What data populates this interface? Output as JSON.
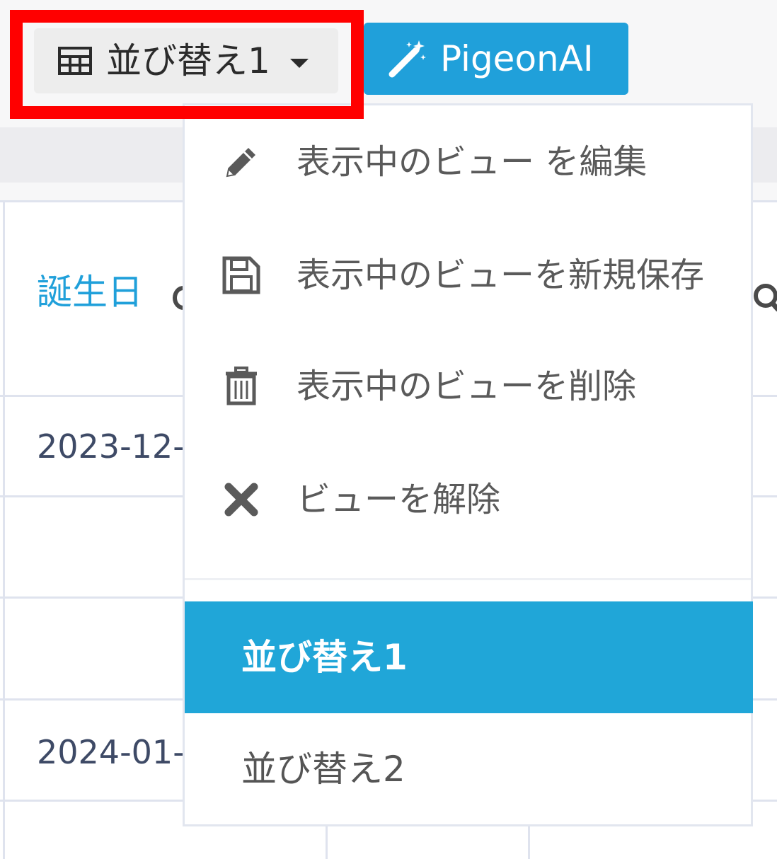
{
  "toolbar": {
    "view_button_label": "並び替え1",
    "ai_button_label": "PigeonAI"
  },
  "table": {
    "column_header": "誕生日",
    "cells": [
      "2023-12-",
      "2024-01-"
    ]
  },
  "dropdown": {
    "actions": [
      {
        "label": "表示中のビュー を編集",
        "icon": "pencil-icon"
      },
      {
        "label": "表示中のビューを新規保存",
        "icon": "save-icon"
      },
      {
        "label": "表示中のビューを削除",
        "icon": "trash-icon"
      },
      {
        "label": "ビューを解除",
        "icon": "close-icon"
      }
    ],
    "views": [
      {
        "label": "並び替え1",
        "selected": true
      },
      {
        "label": "並び替え2",
        "selected": false
      }
    ]
  },
  "colors": {
    "accent": "#20a0da",
    "highlight": "#ff0000"
  }
}
